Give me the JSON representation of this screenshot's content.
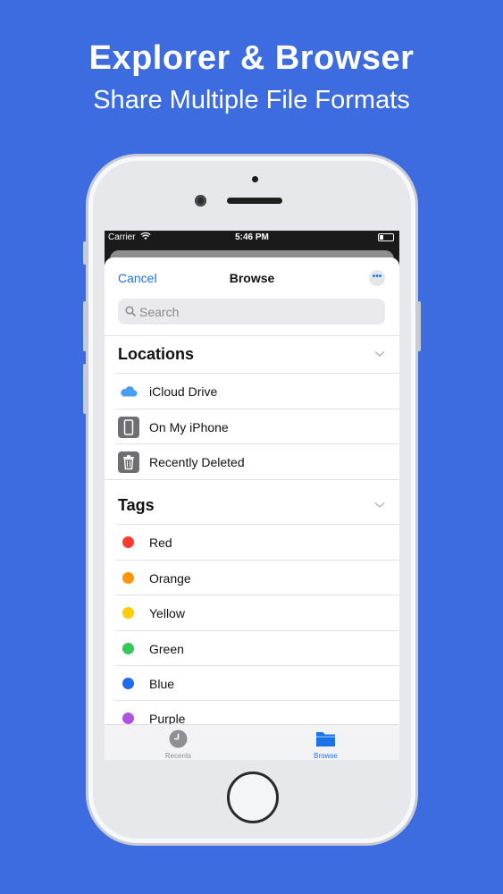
{
  "promo": {
    "headline": "Explorer & Browser",
    "subline": "Share Multiple File Formats"
  },
  "statusbar": {
    "carrier": "Carrier",
    "time": "5:46 PM"
  },
  "nav": {
    "cancel_label": "Cancel",
    "title": "Browse",
    "more_icon": "ellipsis-icon"
  },
  "search": {
    "placeholder": "Search"
  },
  "locations": {
    "title": "Locations",
    "items": [
      {
        "label": "iCloud Drive",
        "icon": "cloud-icon"
      },
      {
        "label": "On My iPhone",
        "icon": "phone-icon"
      },
      {
        "label": "Recently Deleted",
        "icon": "trash-icon"
      }
    ]
  },
  "tags": {
    "title": "Tags",
    "items": [
      {
        "label": "Red",
        "color": "#ff3b30"
      },
      {
        "label": "Orange",
        "color": "#ff9500"
      },
      {
        "label": "Yellow",
        "color": "#ffcc00"
      },
      {
        "label": "Green",
        "color": "#34c759"
      },
      {
        "label": "Blue",
        "color": "#1f6bf2"
      },
      {
        "label": "Purple",
        "color": "#af52de"
      }
    ]
  },
  "tabbar": {
    "tabs": [
      {
        "label": "Recents",
        "icon": "clock-icon",
        "active": false
      },
      {
        "label": "Browse",
        "icon": "folder-icon",
        "active": true
      }
    ]
  },
  "colors": {
    "background": "#3d6be0",
    "accent": "#1a73e8"
  }
}
